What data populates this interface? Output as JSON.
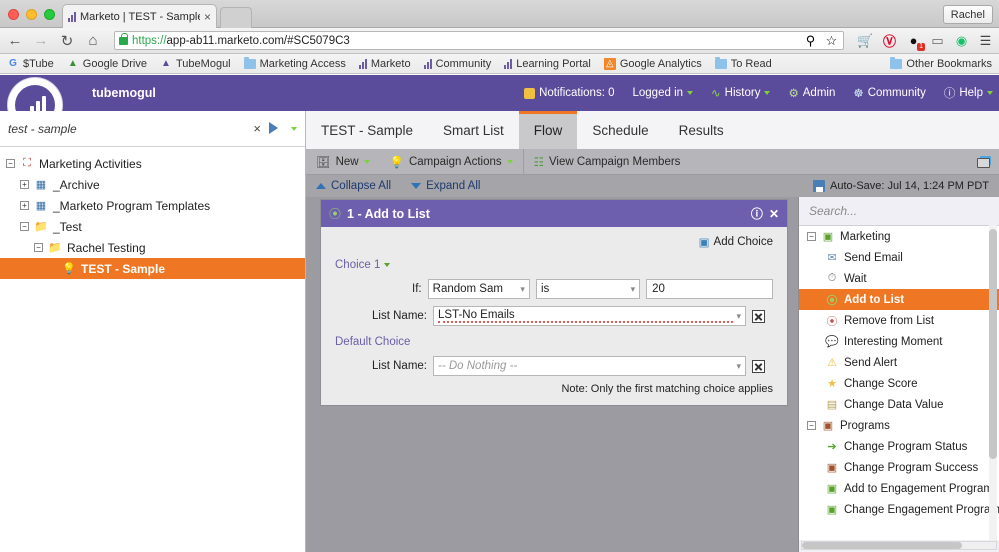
{
  "browser": {
    "tab": {
      "title": "Marketo | TEST - Sample",
      "close_label": "×"
    },
    "profile_button": "Rachel",
    "nav": {
      "back": "←",
      "forward": "→",
      "reload": "↻",
      "home": "⌂"
    },
    "url": {
      "scheme": "https://",
      "rest": "app-ab11.marketo.com/#SC5079C3"
    },
    "omnibox_icons": [
      "search-icon",
      "star-icon"
    ],
    "extensions": [
      "cart-icon",
      "pinterest-icon",
      "honey-icon",
      "cast-icon",
      "grammarly-icon",
      "menu-icon"
    ],
    "extension_badge": "1",
    "bookmarks": [
      {
        "label": "$Tube",
        "icon": "google-icon"
      },
      {
        "label": "Google Drive",
        "icon": "drive-icon"
      },
      {
        "label": "TubeMogul",
        "icon": "tubemogul-icon"
      },
      {
        "label": "Marketing Access",
        "icon": "folder-icon"
      },
      {
        "label": "Marketo",
        "icon": "marketo-bars-icon"
      },
      {
        "label": "Community",
        "icon": "marketo-bars-icon"
      },
      {
        "label": "Learning Portal",
        "icon": "marketo-bars-icon"
      },
      {
        "label": "Google Analytics",
        "icon": "analytics-icon"
      },
      {
        "label": "To Read",
        "icon": "folder-icon"
      }
    ],
    "other_bookmarks": "Other Bookmarks"
  },
  "marketo_header": {
    "tenant": "tubemogul",
    "nav": [
      {
        "label": "Notifications: 0",
        "icon": "notification-icon",
        "caret": false
      },
      {
        "label": "Logged in",
        "icon": "",
        "caret": true
      },
      {
        "label": "History",
        "icon": "history-icon",
        "caret": true
      },
      {
        "label": "Admin",
        "icon": "gear-icon",
        "caret": false
      },
      {
        "label": "Community",
        "icon": "community-icon",
        "caret": false
      },
      {
        "label": "Help",
        "icon": "help-icon",
        "caret": true
      }
    ]
  },
  "left_panel": {
    "search_value": "test - sample",
    "clear_label": "×",
    "tree": [
      {
        "label": "Marketing Activities",
        "depth": 0,
        "expander": "−",
        "icon": "building-icon",
        "selected": false
      },
      {
        "label": "_Archive",
        "depth": 1,
        "expander": "+",
        "icon": "program-icon",
        "selected": false
      },
      {
        "label": "_Marketo Program Templates",
        "depth": 1,
        "expander": "+",
        "icon": "program-icon",
        "selected": false
      },
      {
        "label": "_Test",
        "depth": 1,
        "expander": "−",
        "icon": "folder-icon",
        "selected": false
      },
      {
        "label": "Rachel Testing",
        "depth": 2,
        "expander": "−",
        "icon": "folder-icon",
        "selected": false
      },
      {
        "label": "TEST - Sample",
        "depth": 3,
        "expander": "",
        "icon": "bulb-icon",
        "selected": true
      }
    ]
  },
  "tabs": [
    {
      "label": "TEST - Sample",
      "active": false
    },
    {
      "label": "Smart List",
      "active": false
    },
    {
      "label": "Flow",
      "active": true
    },
    {
      "label": "Schedule",
      "active": false
    },
    {
      "label": "Results",
      "active": false
    }
  ],
  "toolbar": {
    "items": [
      {
        "label": "New",
        "icon": "new-icon",
        "caret": true
      },
      {
        "label": "Campaign Actions",
        "icon": "bulb-icon",
        "caret": true
      },
      {
        "label": "View Campaign Members",
        "icon": "members-icon",
        "caret": false
      }
    ],
    "window_icon": "restore-window-icon"
  },
  "subtoolbar": {
    "collapse_all": "Collapse All",
    "expand_all": "Expand All",
    "autosave": "Auto-Save: Jul 14, 1:24 PM PDT"
  },
  "flow_step": {
    "title": "1 - Add to List",
    "info_icon": "info-icon",
    "close_icon": "close-icon",
    "add_choice": "Add Choice",
    "choice_label": "Choice 1",
    "if_label": "If:",
    "if_attribute": "Random Sam",
    "if_operator": "is",
    "if_value": "20",
    "list_name_label": "List Name:",
    "list_name_value": "LST-No Emails",
    "default_choice_label": "Default Choice",
    "default_list_name_label": "List Name:",
    "default_list_name_value": "-- Do Nothing --",
    "note": "Note: Only the first matching choice applies"
  },
  "palette": {
    "search_placeholder": "Search...",
    "items": [
      {
        "label": "Marketing",
        "group": true,
        "icon": "marketing-group-icon",
        "selected": false
      },
      {
        "label": "Send Email",
        "group": false,
        "icon": "email-icon",
        "selected": false
      },
      {
        "label": "Wait",
        "group": false,
        "icon": "clock-icon",
        "selected": false
      },
      {
        "label": "Add to List",
        "group": false,
        "icon": "add-to-list-icon",
        "selected": true
      },
      {
        "label": "Remove from List",
        "group": false,
        "icon": "remove-from-list-icon",
        "selected": false
      },
      {
        "label": "Interesting Moment",
        "group": false,
        "icon": "moment-icon",
        "selected": false
      },
      {
        "label": "Send Alert",
        "group": false,
        "icon": "alert-icon",
        "selected": false
      },
      {
        "label": "Change Score",
        "group": false,
        "icon": "star-icon",
        "selected": false
      },
      {
        "label": "Change Data Value",
        "group": false,
        "icon": "data-value-icon",
        "selected": false
      },
      {
        "label": "Programs",
        "group": true,
        "icon": "programs-group-icon",
        "selected": false
      },
      {
        "label": "Change Program Status",
        "group": false,
        "icon": "program-status-icon",
        "selected": false
      },
      {
        "label": "Change Program Success",
        "group": false,
        "icon": "program-success-icon",
        "selected": false
      },
      {
        "label": "Add to Engagement Program",
        "group": false,
        "icon": "add-engagement-icon",
        "selected": false
      },
      {
        "label": "Change Engagement Program Ca",
        "group": false,
        "icon": "change-engagement-icon",
        "selected": false
      }
    ]
  },
  "colors": {
    "marketo_purple": "#5b4b9b",
    "card_header_purple": "#6d5fae",
    "accent_orange": "#ef7622",
    "link_purple": "#6a5fa8",
    "main_gray": "#9b9ba1"
  }
}
